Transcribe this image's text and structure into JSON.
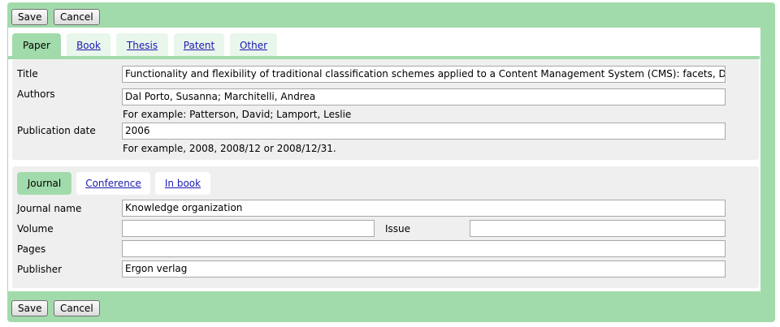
{
  "toolbar": {
    "save_label": "Save",
    "cancel_label": "Cancel"
  },
  "tabs": [
    {
      "label": "Paper",
      "active": true
    },
    {
      "label": "Book",
      "active": false
    },
    {
      "label": "Thesis",
      "active": false
    },
    {
      "label": "Patent",
      "active": false
    },
    {
      "label": "Other",
      "active": false
    }
  ],
  "paper": {
    "title_label": "Title",
    "title_value": "Functionality and flexibility of traditional classification schemes applied to a Content Management System (CMS): facets, DDC, JITA",
    "authors_label": "Authors",
    "authors_value": "Dal Porto, Susanna; Marchitelli, Andrea",
    "authors_hint": "For example: Patterson, David; Lamport, Leslie",
    "date_label": "Publication date",
    "date_value": "2006",
    "date_hint": "For example, 2008, 2008/12 or 2008/12/31."
  },
  "subtabs": [
    {
      "label": "Journal",
      "active": true
    },
    {
      "label": "Conference",
      "active": false
    },
    {
      "label": "In book",
      "active": false
    }
  ],
  "journal": {
    "name_label": "Journal name",
    "name_value": "Knowledge organization",
    "volume_label": "Volume",
    "volume_value": "",
    "issue_label": "Issue",
    "issue_value": "",
    "pages_label": "Pages",
    "pages_value": "",
    "publisher_label": "Publisher",
    "publisher_value": "Ergon verlag"
  },
  "colors": {
    "accent_green": "#a2dbab",
    "link": "#1a1ab0",
    "panel": "#efefef"
  }
}
